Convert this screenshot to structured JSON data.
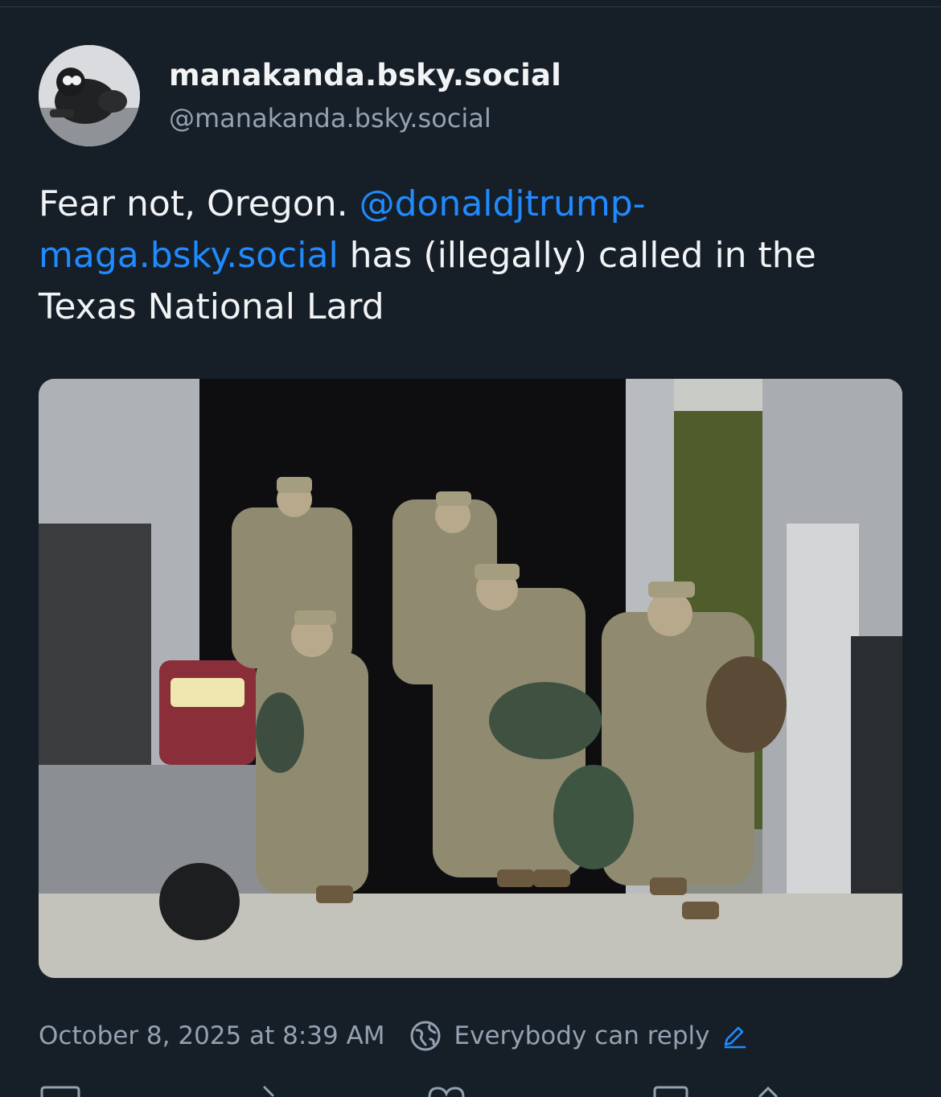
{
  "author": {
    "display_name": "manakanda.bsky.social",
    "handle": "@manakanda.bsky.social",
    "avatar_icon": "avatar-image"
  },
  "post": {
    "text_before": "Fear not, Oregon. ",
    "mention": "@donaldjtrump-maga.bsky.social",
    "text_after": " has (illegally) called in the Texas National Lard",
    "image_icon": "photo-soldiers-unloading-truck"
  },
  "meta": {
    "timestamp": "October 8, 2025 at 8:39 AM",
    "reply_setting": "Everybody can reply",
    "reply_icon": "globe-icon",
    "edit_icon": "pencil-icon"
  },
  "colors": {
    "background": "#161e27",
    "text": "#f1f3f5",
    "secondary": "#93a1b1",
    "link": "#208bfe"
  }
}
